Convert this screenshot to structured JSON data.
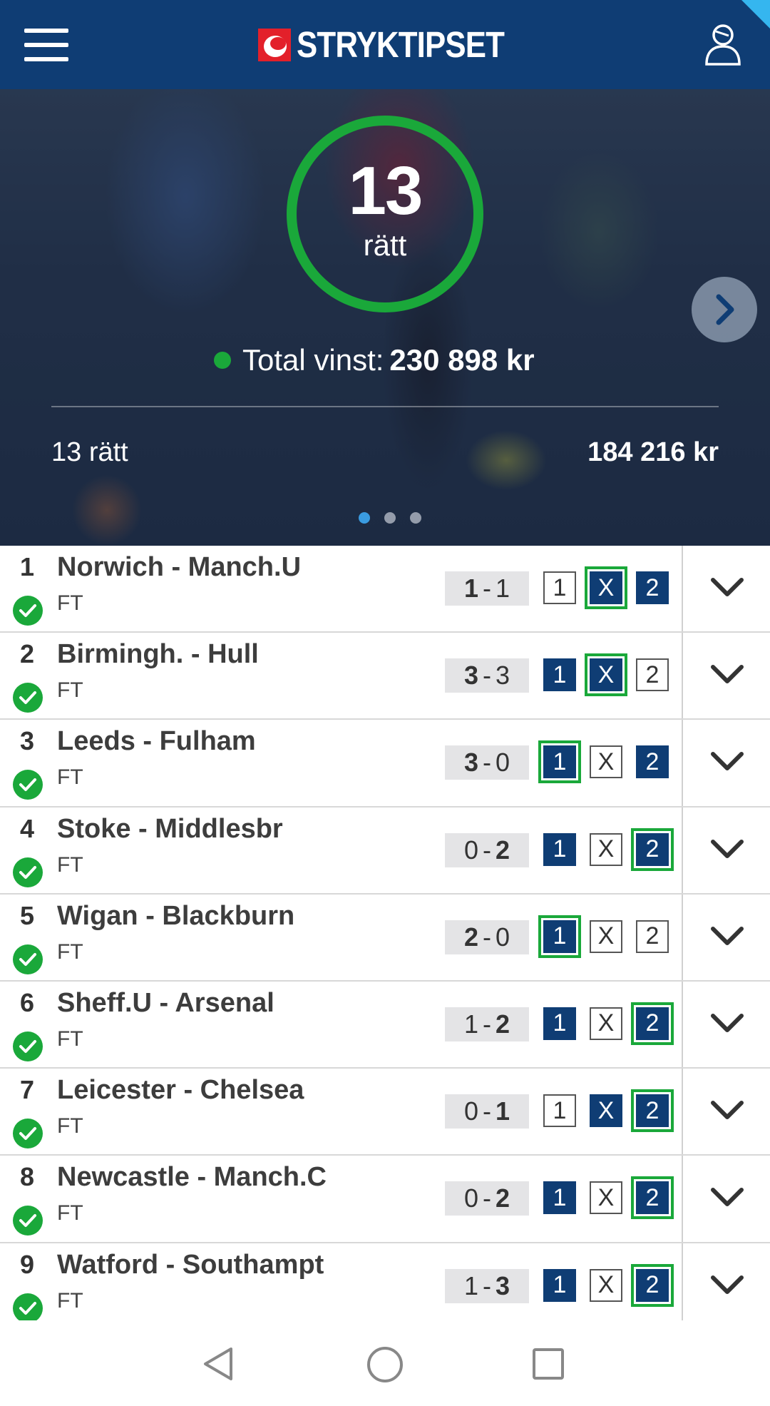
{
  "header": {
    "logo_text": "STRYKTIPSET",
    "menu_icon": "hamburger-menu-icon",
    "user_icon": "user-profile-icon",
    "brand_color": "#0f3d74"
  },
  "hero": {
    "correct_count": "13",
    "correct_label": "rätt",
    "total_label": "Total vinst:",
    "total_value": "230 898 kr",
    "prize_label": "13 rätt",
    "prize_value": "184 216 kr",
    "carousel_pages": 3,
    "carousel_active": 1,
    "accent_color": "#1aa83a"
  },
  "matches": [
    {
      "num": "1",
      "teams": "Norwich - Manch.U",
      "status": "FT",
      "home": "1",
      "away": "1",
      "bold": "home",
      "picks": {
        "1": false,
        "X": true,
        "2": true
      },
      "outcome": "X"
    },
    {
      "num": "2",
      "teams": "Birmingh. - Hull",
      "status": "FT",
      "home": "3",
      "away": "3",
      "bold": "home",
      "picks": {
        "1": true,
        "X": true,
        "2": false
      },
      "outcome": "X"
    },
    {
      "num": "3",
      "teams": "Leeds - Fulham",
      "status": "FT",
      "home": "3",
      "away": "0",
      "bold": "home",
      "picks": {
        "1": true,
        "X": false,
        "2": true
      },
      "outcome": "1"
    },
    {
      "num": "4",
      "teams": "Stoke - Middlesbr",
      "status": "FT",
      "home": "0",
      "away": "2",
      "bold": "away",
      "picks": {
        "1": true,
        "X": false,
        "2": true
      },
      "outcome": "2"
    },
    {
      "num": "5",
      "teams": "Wigan - Blackburn",
      "status": "FT",
      "home": "2",
      "away": "0",
      "bold": "home",
      "picks": {
        "1": true,
        "X": false,
        "2": false
      },
      "outcome": "1"
    },
    {
      "num": "6",
      "teams": "Sheff.U - Arsenal",
      "status": "FT",
      "home": "1",
      "away": "2",
      "bold": "away",
      "picks": {
        "1": true,
        "X": false,
        "2": true
      },
      "outcome": "2"
    },
    {
      "num": "7",
      "teams": "Leicester - Chelsea",
      "status": "FT",
      "home": "0",
      "away": "1",
      "bold": "away",
      "picks": {
        "1": false,
        "X": true,
        "2": true
      },
      "outcome": "2"
    },
    {
      "num": "8",
      "teams": "Newcastle - Manch.C",
      "status": "FT",
      "home": "0",
      "away": "2",
      "bold": "away",
      "picks": {
        "1": true,
        "X": false,
        "2": true
      },
      "outcome": "2"
    },
    {
      "num": "9",
      "teams": "Watford - Southampt",
      "status": "FT",
      "home": "1",
      "away": "3",
      "bold": "away",
      "picks": {
        "1": true,
        "X": false,
        "2": true
      },
      "outcome": "2"
    }
  ],
  "sign_labels": {
    "one": "1",
    "x": "X",
    "two": "2"
  },
  "score_separator": "-",
  "navbar": {
    "back_icon": "back-triangle-icon",
    "home_icon": "home-circle-icon",
    "recents_icon": "recents-square-icon"
  }
}
